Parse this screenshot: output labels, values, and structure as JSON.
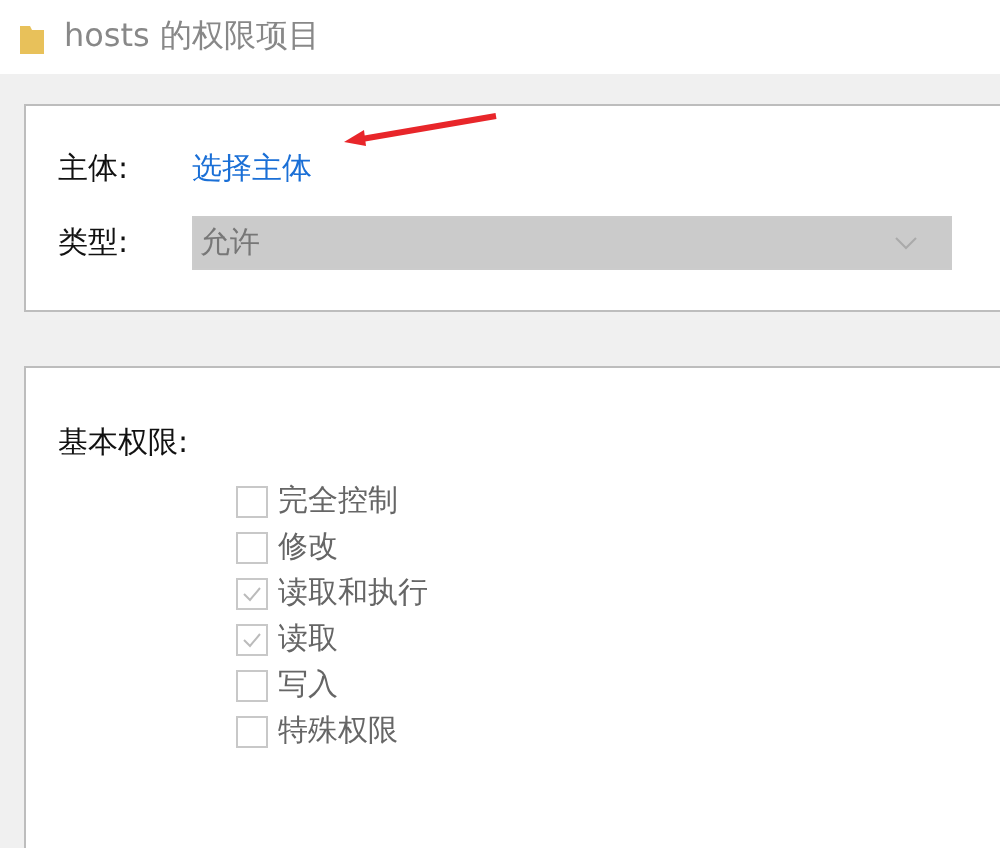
{
  "window": {
    "title": "hosts 的权限项目"
  },
  "principal": {
    "label": "主体:",
    "link": "选择主体"
  },
  "type": {
    "label": "类型:",
    "value": "允许",
    "disabled": true
  },
  "permissions": {
    "heading": "基本权限:",
    "items": [
      {
        "label": "完全控制",
        "checked": false,
        "disabled": true
      },
      {
        "label": "修改",
        "checked": false,
        "disabled": true
      },
      {
        "label": "读取和执行",
        "checked": true,
        "disabled": true
      },
      {
        "label": "读取",
        "checked": true,
        "disabled": true
      },
      {
        "label": "写入",
        "checked": false,
        "disabled": true
      },
      {
        "label": "特殊权限",
        "checked": false,
        "disabled": true
      }
    ]
  }
}
